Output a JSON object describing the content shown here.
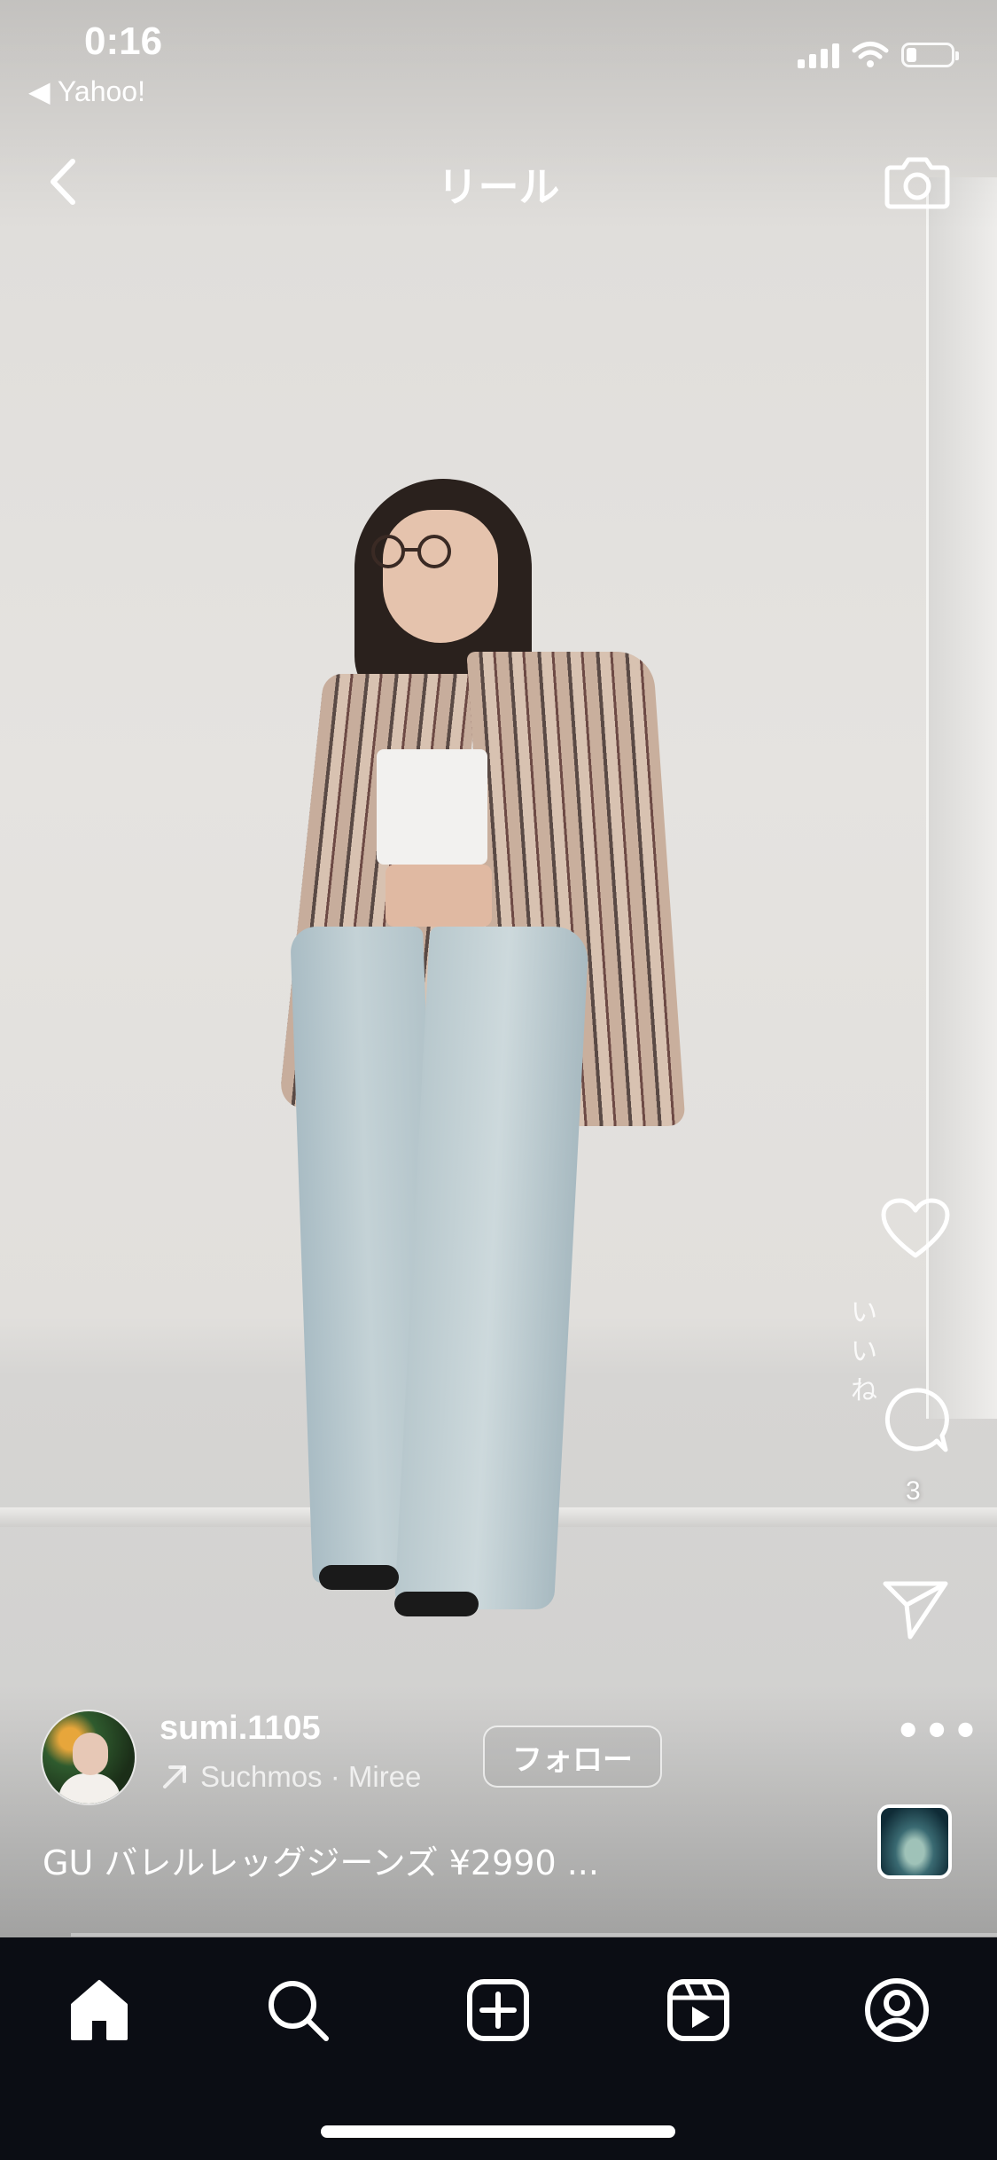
{
  "status_bar": {
    "time": "0:16",
    "back_to_app": "◀ Yahoo!",
    "battery_level": 0.22
  },
  "header": {
    "title": "リール",
    "back_icon": "chevron-left-icon",
    "camera_icon": "camera-icon"
  },
  "actions": {
    "like_label": "いいね",
    "comment_count": "3",
    "more_label": "•••"
  },
  "post": {
    "username": "sumi.1105",
    "audio": "Suchmos · Miree",
    "follow_label": "フォロー",
    "caption": "GU バレルレッグジーンズ ¥2990 ..."
  },
  "tabbar": {
    "items": [
      "home-icon",
      "search-icon",
      "create-icon",
      "reels-icon",
      "profile-icon"
    ]
  },
  "colors": {
    "tabbar_bg": "#0b0d14",
    "text": "#ffffff"
  }
}
